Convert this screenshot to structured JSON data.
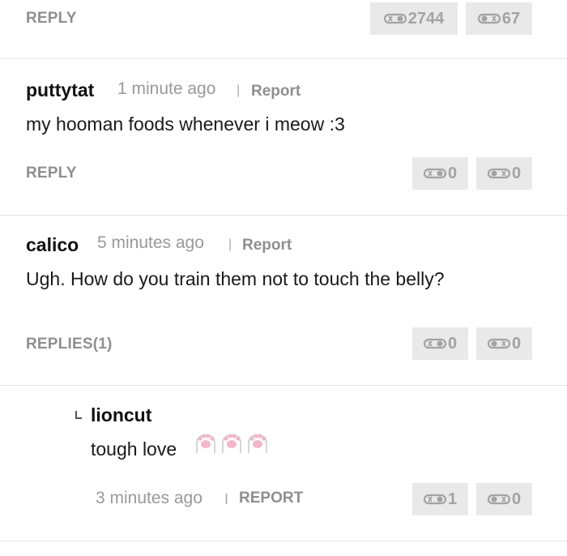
{
  "colors": {
    "vote_bg": "#e9e9e9",
    "vote_text": "#a3a3a3",
    "muted": "#8f8f8f",
    "paw_pink": "#f4b6c8"
  },
  "top": {
    "reply_label": "REPLY",
    "upvotes": "2744",
    "downvotes": "67"
  },
  "comments": [
    {
      "username": "puttytat",
      "time": "1 minute ago",
      "separator": "|",
      "report_label": "Report",
      "text": "my hooman foods whenever i meow :3",
      "reply_label": "REPLY",
      "upvotes": "0",
      "downvotes": "0"
    },
    {
      "username": "calico",
      "time": "5 minutes ago",
      "separator": "|",
      "report_label": "Report",
      "text": "Ugh. How do you train them not to touch the belly?",
      "reply_label": "REPLIES(1)",
      "upvotes": "0",
      "downvotes": "0"
    }
  ],
  "nested_reply": {
    "username": "lioncut",
    "text": "tough love",
    "emoji": [
      "paw-emoji",
      "paw-emoji",
      "paw-emoji"
    ],
    "time": "3 minutes ago",
    "separator": "I",
    "report_label": "REPORT",
    "upvotes": "1",
    "downvotes": "0"
  }
}
